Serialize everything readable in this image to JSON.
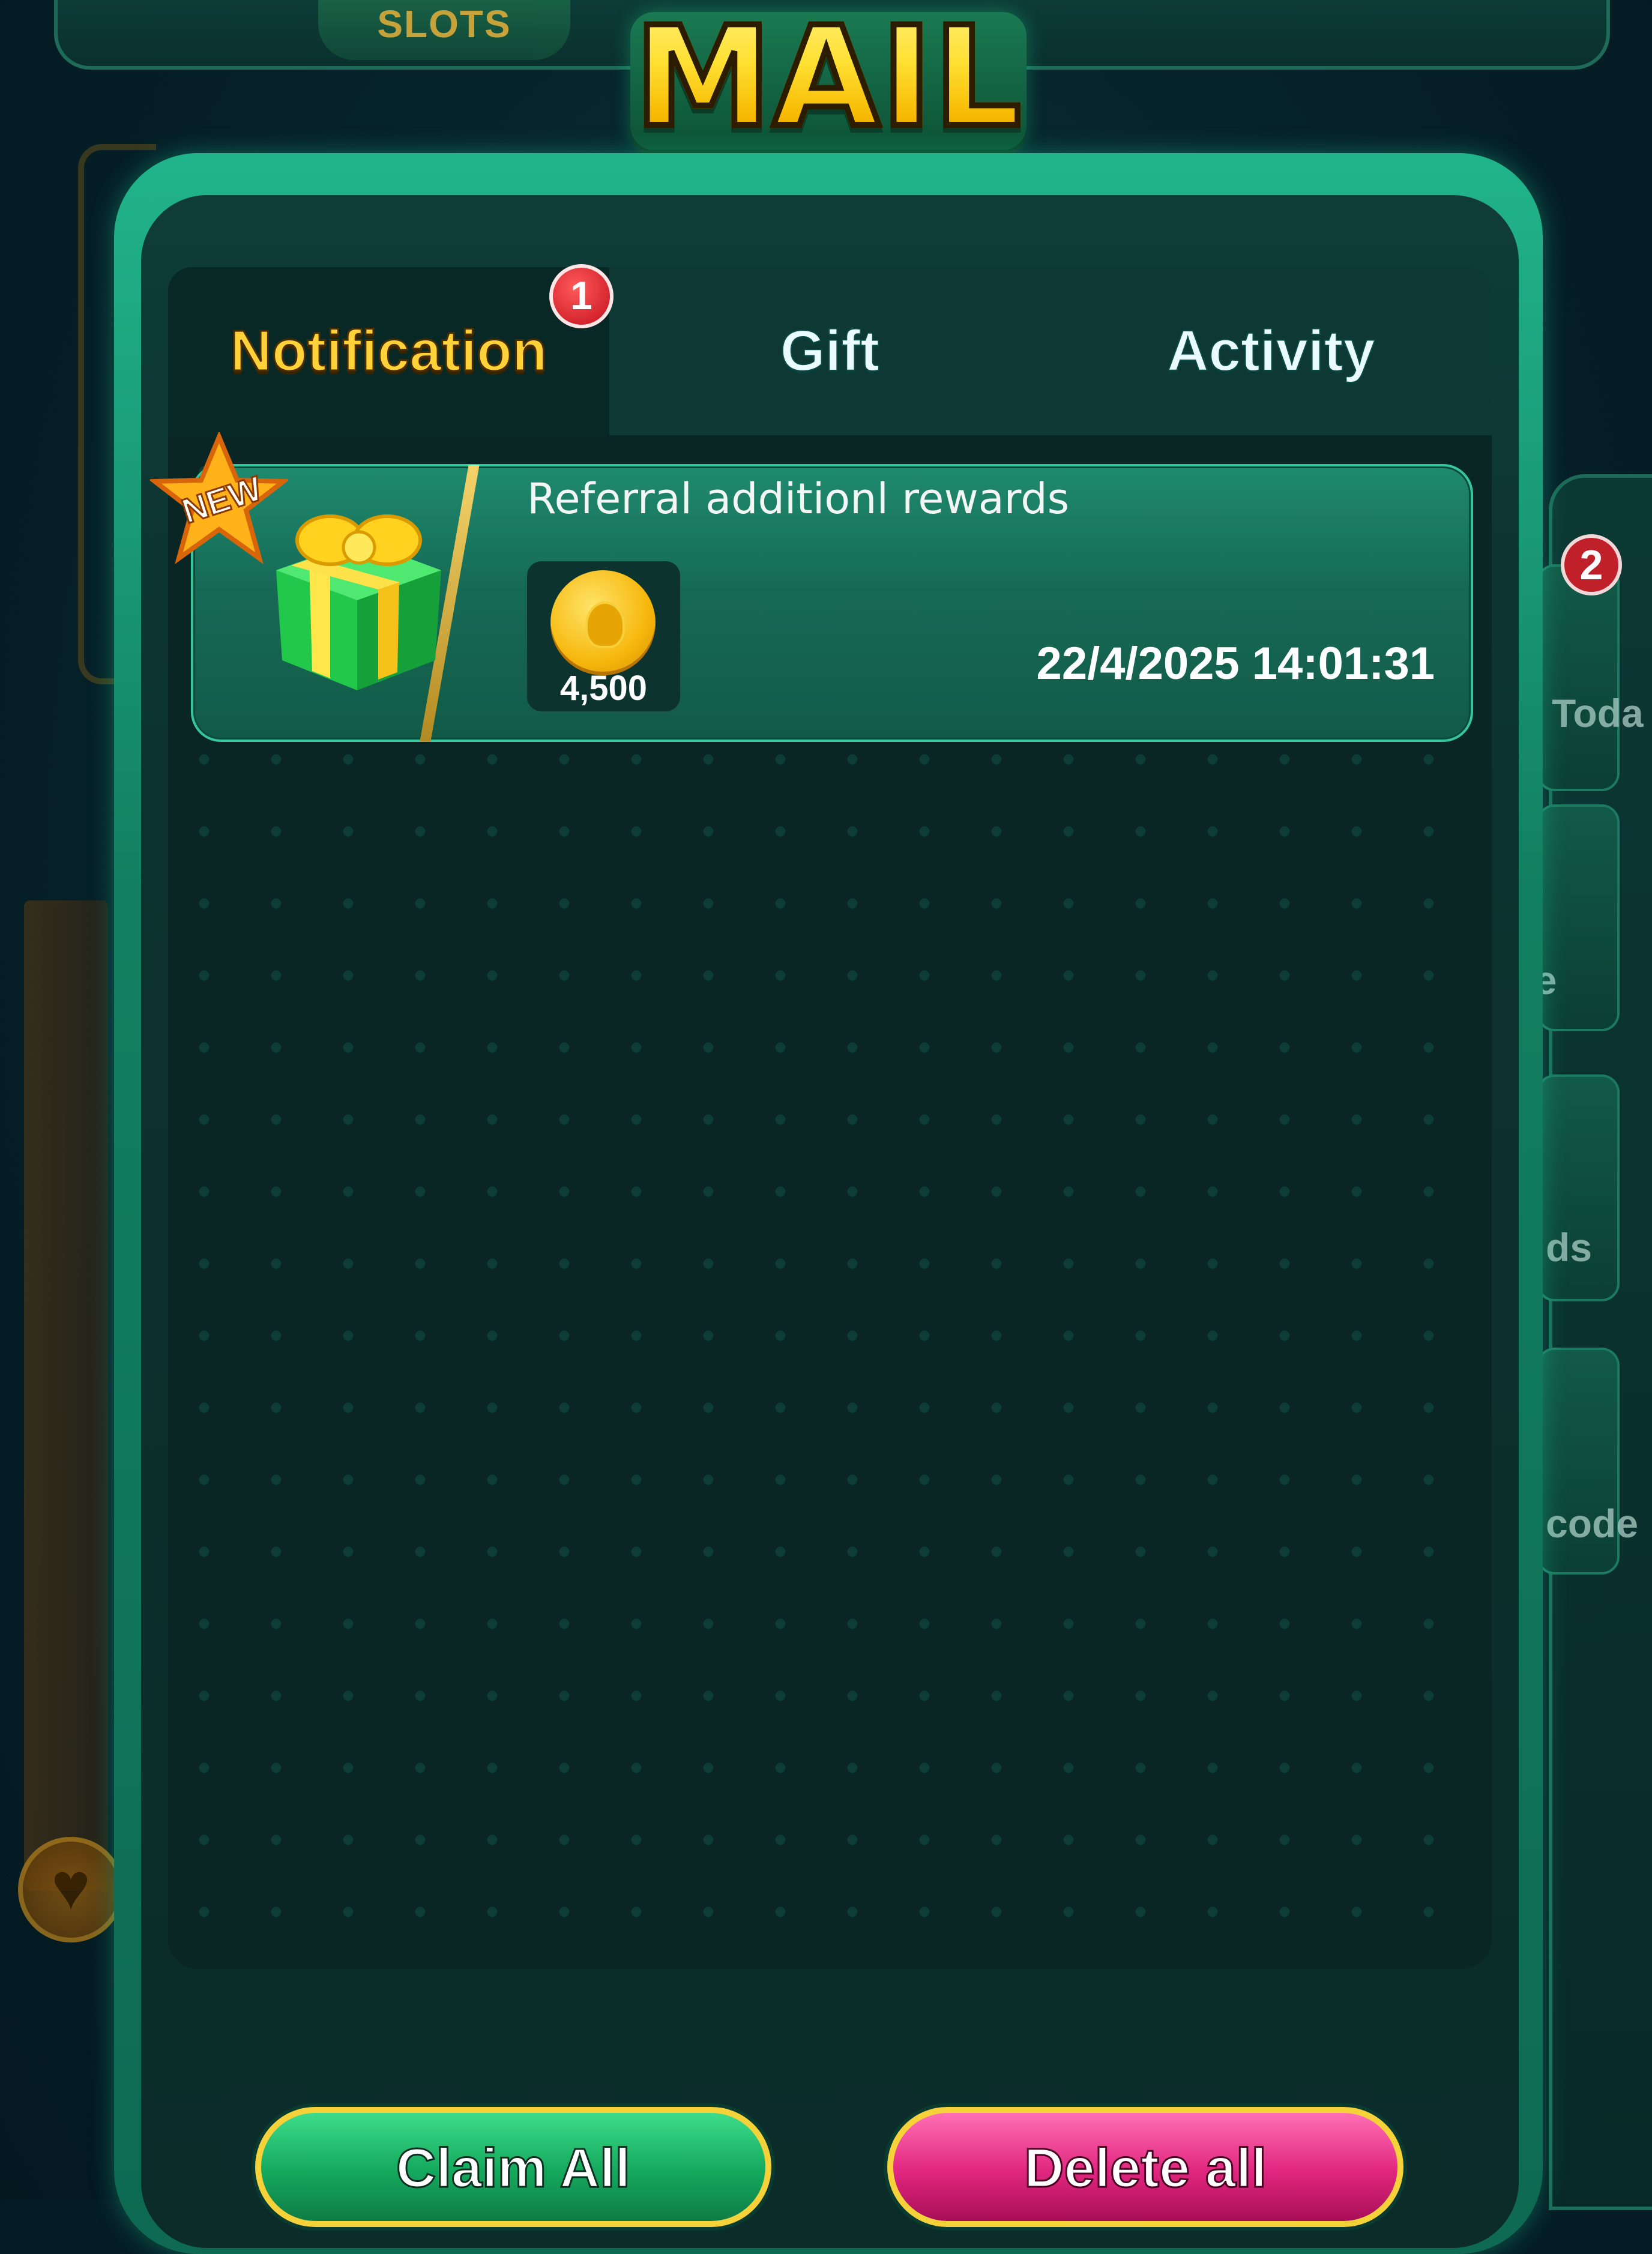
{
  "background": {
    "top_nav_label": "SLOTS",
    "side_labels": [
      "Toda",
      "ce",
      "ds",
      "code"
    ],
    "side_badge_count": "2"
  },
  "title": "MAIL",
  "tabs": [
    {
      "label": "Notification",
      "active": true,
      "badge": "1"
    },
    {
      "label": "Gift",
      "active": false
    },
    {
      "label": "Activity",
      "active": false
    }
  ],
  "mails": [
    {
      "tag": "NEW",
      "icon": "gift-box-icon",
      "title": "Referral additionl rewards",
      "reward": {
        "icon": "coin-icon",
        "amount": "4,500"
      },
      "date": "22/4/2025 14:01:31"
    }
  ],
  "buttons": {
    "claim_all": "Claim All",
    "delete_all": "Delete all"
  },
  "colors": {
    "panel": "#128060",
    "active_tab_text": "#ffd23a",
    "claim_button": "#14a85d",
    "delete_button": "#e0267f"
  }
}
